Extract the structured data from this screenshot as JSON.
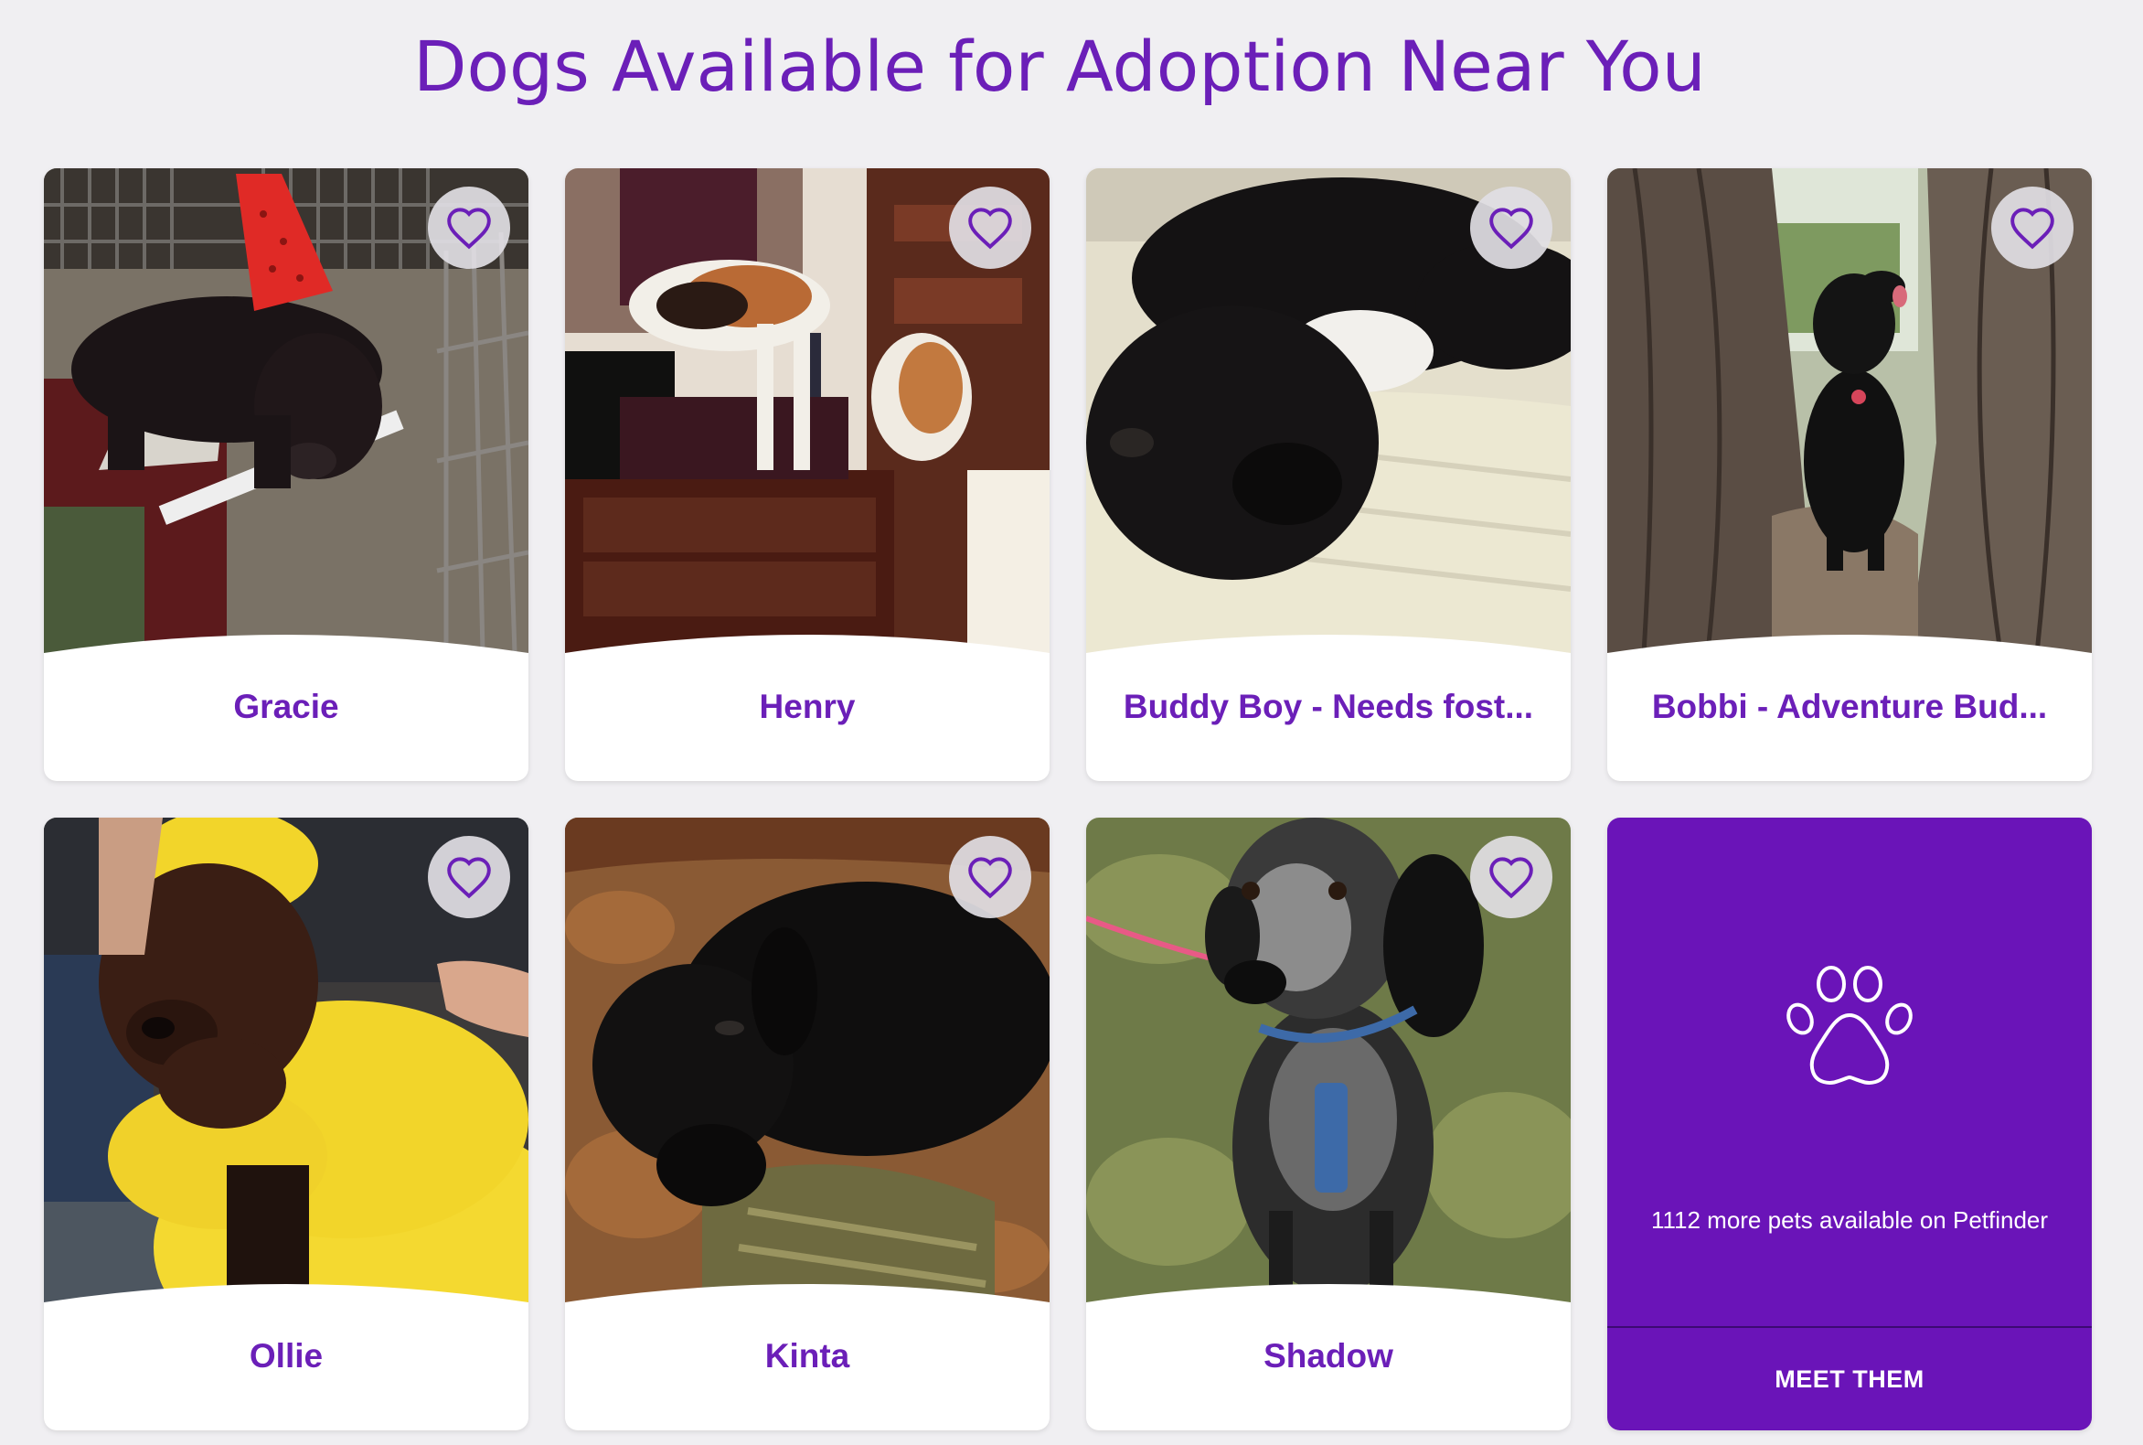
{
  "page": {
    "title": "Dogs Available for Adoption Near You"
  },
  "pets": [
    {
      "name": "Gracie",
      "favorite_icon": "heart-outline-icon"
    },
    {
      "name": "Henry",
      "favorite_icon": "heart-outline-icon"
    },
    {
      "name": "Buddy Boy - Needs fost...",
      "favorite_icon": "heart-outline-icon"
    },
    {
      "name": "Bobbi - Adventure Bud...",
      "favorite_icon": "heart-outline-icon"
    },
    {
      "name": "Ollie",
      "favorite_icon": "heart-outline-icon"
    },
    {
      "name": "Kinta",
      "favorite_icon": "heart-outline-icon"
    },
    {
      "name": "Shadow",
      "favorite_icon": "heart-outline-icon"
    }
  ],
  "more_card": {
    "icon": "paw-icon",
    "text": "1112 more pets available on Petfinder",
    "button_label": "MEET THEM"
  },
  "colors": {
    "brand_purple": "#6b1fb8",
    "card_purple": "#6a14b8",
    "background": "#f0eff2"
  }
}
